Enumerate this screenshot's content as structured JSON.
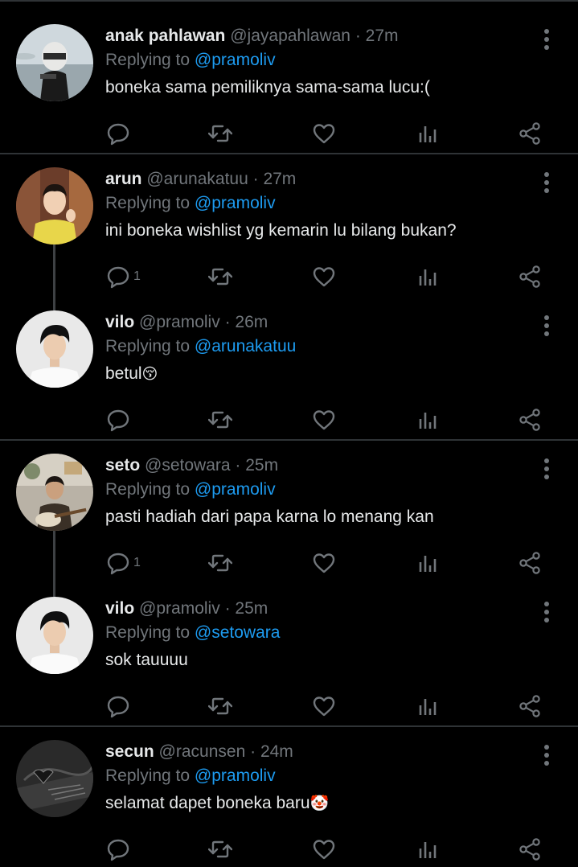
{
  "tweets": [
    {
      "name": "anak pahlawan",
      "handle": "@jayapahlawan",
      "dot": "·",
      "time": "27m",
      "replying_prefix": "Replying to",
      "replying_to": "@pramoliv",
      "text": "boneka sama pemiliknya sama-sama lucu:(",
      "emoji": "",
      "reply_count": "",
      "avatar": "helmet-rider-avatar"
    },
    {
      "name": "arun",
      "handle": "@arunakatuu",
      "dot": "·",
      "time": "27m",
      "replying_prefix": "Replying to",
      "replying_to": "@pramoliv",
      "text": "ini boneka wishlist yg kemarin lu bilang bukan?",
      "emoji": "",
      "reply_count": "1",
      "avatar": "yellow-shirt-boy-avatar"
    },
    {
      "name": "vilo",
      "handle": "@pramoliv",
      "dot": "·",
      "time": "26m",
      "replying_prefix": "Replying to",
      "replying_to": "@arunakatuu",
      "text": "betul",
      "emoji": "😚",
      "reply_count": "",
      "avatar": "white-shirt-boy-avatar"
    },
    {
      "name": "seto",
      "handle": "@setowara",
      "dot": "·",
      "time": "25m",
      "replying_prefix": "Replying to",
      "replying_to": "@pramoliv",
      "text": "pasti hadiah dari papa karna lo menang kan",
      "emoji": "",
      "reply_count": "1",
      "avatar": "guitar-boy-avatar"
    },
    {
      "name": "vilo",
      "handle": "@pramoliv",
      "dot": "·",
      "time": "25m",
      "replying_prefix": "Replying to",
      "replying_to": "@setowara",
      "text": "sok tauuuu",
      "emoji": "",
      "reply_count": "",
      "avatar": "white-shirt-boy-avatar"
    },
    {
      "name": "secun",
      "handle": "@racunsen",
      "dot": "·",
      "time": "24m",
      "replying_prefix": "Replying to",
      "replying_to": "@pramoliv",
      "text": "selamat dapet boneka baru",
      "emoji": "🤡",
      "reply_count": "",
      "avatar": "dark-textured-avatar"
    }
  ],
  "colors": {
    "background": "#000000",
    "text": "#e7e9ea",
    "muted": "#71767b",
    "accent": "#1d9bf0",
    "divider": "#2f3336"
  }
}
